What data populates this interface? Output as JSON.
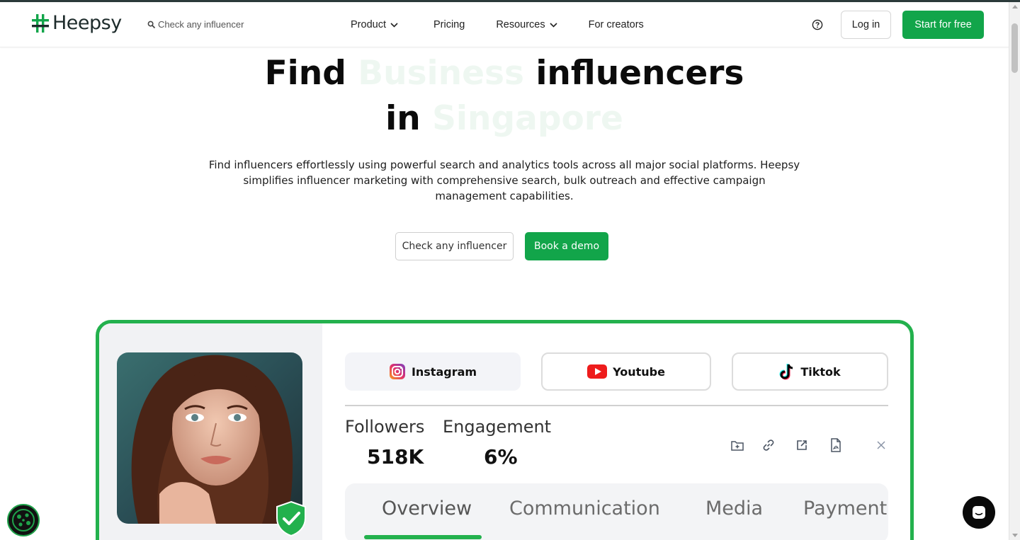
{
  "header": {
    "logo_text": "Heepsy",
    "search_placeholder": "Check any influencer",
    "nav": [
      {
        "label": "Product",
        "has_dropdown": true
      },
      {
        "label": "Pricing",
        "has_dropdown": false
      },
      {
        "label": "Resources",
        "has_dropdown": true
      },
      {
        "label": "For creators",
        "has_dropdown": false
      }
    ],
    "help_icon": "question-circle-icon",
    "login_label": "Log in",
    "start_label": "Start for free"
  },
  "hero": {
    "title_word_1": "Find",
    "title_word_2": "Business",
    "title_word_3": "influencers",
    "title_word_4": "in",
    "title_word_5": "Singapore",
    "description": "Find influencers effortlessly using powerful search and analytics tools across all major social platforms. Heepsy simplifies influencer marketing with comprehensive search, bulk outreach and effective campaign management capabilities.",
    "check_label": "Check any influencer",
    "demo_label": "Book a demo"
  },
  "preview": {
    "platforms": [
      {
        "label": "Instagram",
        "icon": "instagram-icon"
      },
      {
        "label": "Youtube",
        "icon": "youtube-icon"
      },
      {
        "label": "Tiktok",
        "icon": "tiktok-icon"
      }
    ],
    "followers_label": "Followers",
    "followers_value": "518K",
    "engagement_label": "Engagement",
    "engagement_value": "6%",
    "tools": [
      "folder-add-icon",
      "link-icon",
      "external-link-icon",
      "pdf-file-icon",
      "close-icon"
    ],
    "sub_tabs": [
      "Overview",
      "Communication",
      "Media",
      "Payment"
    ],
    "active_sub_tab": "Overview"
  },
  "colors": {
    "brand_green": "#12a54a",
    "card_border": "#23b14d",
    "faded_text": "#eef7f1"
  }
}
